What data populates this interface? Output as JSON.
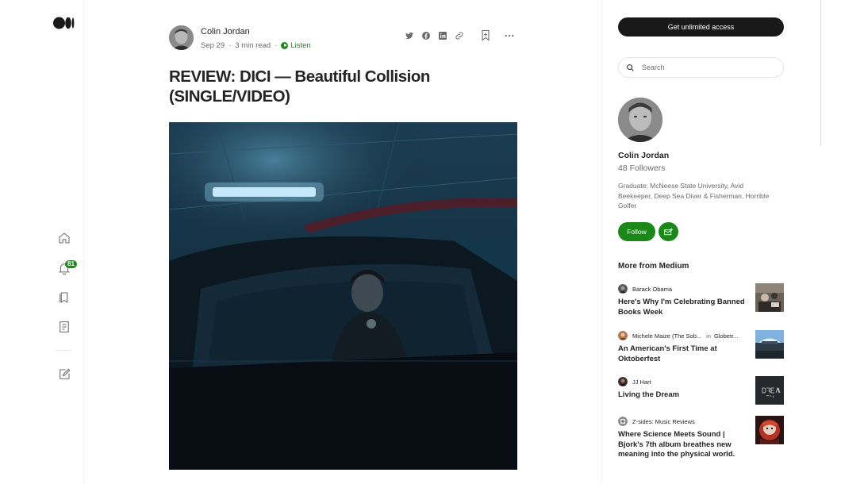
{
  "nav": {
    "logo_icon": "medium-logo-icon",
    "icons": [
      "home-icon",
      "notifications-icon",
      "lists-icon",
      "stories-icon",
      "write-icon"
    ],
    "notification_count": "81"
  },
  "article": {
    "author": "Colin Jordan",
    "date": "Sep 29",
    "separator": "·",
    "read_time": "3 min read",
    "listen_label": "Listen",
    "title": "REVIEW: DICI — Beautiful Collision (SINGLE/VIDEO)",
    "share_icons": [
      "twitter-icon",
      "facebook-icon",
      "linkedin-icon",
      "link-icon"
    ],
    "action_icons": [
      "bookmark-icon",
      "more-icon"
    ]
  },
  "sidebar": {
    "cta_label": "Get unlimited access",
    "search_placeholder": "Search",
    "profile": {
      "name": "Colin Jordan",
      "followers": "48 Followers",
      "bio": "Graduate: McNeese State University, Avid Beekeeper, Deep Sea Diver & Fisherman, Horrible Golfer",
      "follow_label": "Follow",
      "subscribe_icon": "subscribe-mail-icon"
    },
    "more_from_heading": "More from Medium",
    "stories": [
      {
        "author": "Barack Obama",
        "publication": "",
        "title": "Here's Why I'm Celebrating Banned Books Week"
      },
      {
        "author": "Michele Maize (The Sob...",
        "in_label": "in",
        "publication": "Globetr...",
        "title": "An American's First Time at Oktoberfest"
      },
      {
        "author": "JJ Hart",
        "publication": "",
        "title": "Living the Dream"
      },
      {
        "author": "Z-sides: Music Reviews",
        "publication": "",
        "title": "Where Science Meets Sound | Bjork's 7th album breathes new meaning into the physical world."
      }
    ]
  },
  "colors": {
    "accent_green": "#1a8917",
    "dark_button": "#191919",
    "text_primary": "#242424",
    "text_secondary": "#6b6b6b"
  }
}
